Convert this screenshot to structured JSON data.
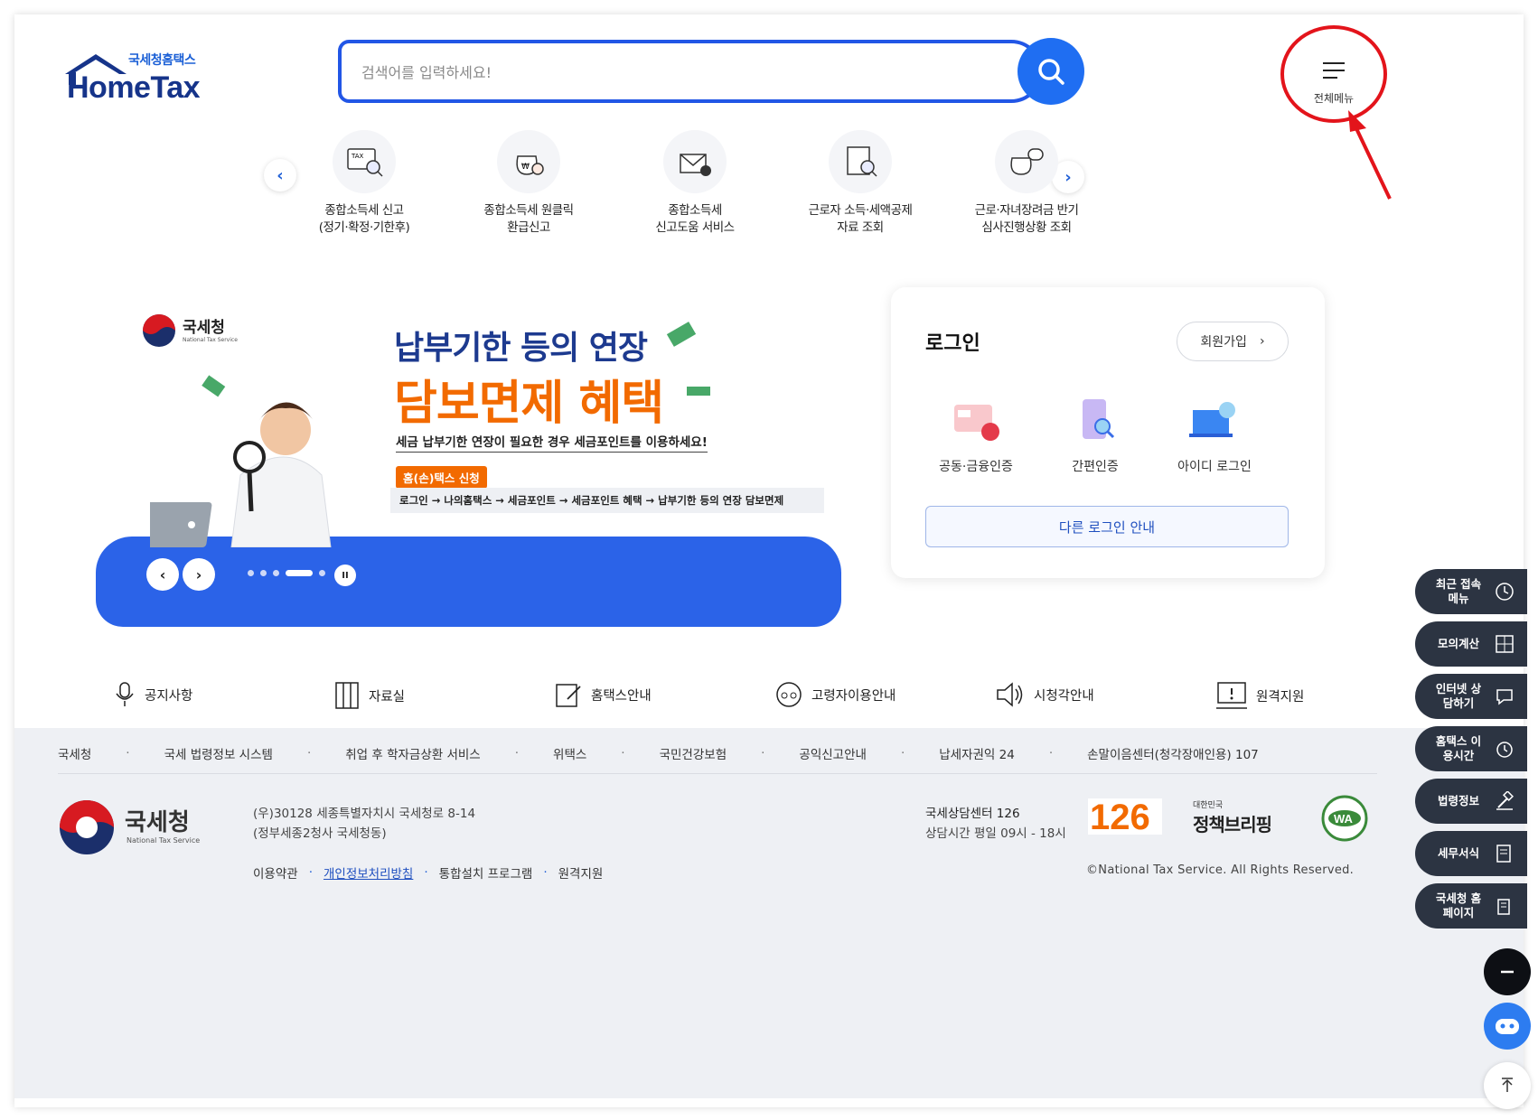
{
  "header": {
    "logo_top": "국세청홈택스",
    "logo_main": "HomeTax",
    "search_placeholder": "검색어를 입력하세요!",
    "all_menu_label": "전체메뉴"
  },
  "quick_services": [
    {
      "line1": "종합소득세 신고",
      "line2": "(정기·확정·기한후)",
      "icon": "tax-monitor-icon"
    },
    {
      "line1": "종합소득세 원클릭",
      "line2": "환급신고",
      "icon": "money-bag-search-icon"
    },
    {
      "line1": "종합소득세",
      "line2": "신고도움 서비스",
      "icon": "tax-envelope-check-icon"
    },
    {
      "line1": "근로자 소득·세액공제",
      "line2": "자료 조회",
      "icon": "document-search-icon"
    },
    {
      "line1": "근로·자녀장려금 반기",
      "line2": "심사진행상황 조회",
      "icon": "money-bag-chat-icon"
    }
  ],
  "banner": {
    "org": "국세청",
    "org_en": "National Tax Service",
    "headline1": "납부기한 등의 연장",
    "headline2": "담보면제 혜택",
    "sub": "세금 납부기한 연장이 필요한 경우 세금포인트를 이용하세요!",
    "tag": "홈(손)택스 신청",
    "path": "로그인 → 나의홈택스 → 세금포인트 → 세금포인트 혜택 → 납부기한 등의 연장 담보면제",
    "prev": "‹",
    "next": "›",
    "pause": "II"
  },
  "login": {
    "title": "로그인",
    "join": "회원가입",
    "options": [
      {
        "label": "공동·금융인증",
        "icon": "certificate-icon"
      },
      {
        "label": "간편인증",
        "icon": "phone-search-icon"
      },
      {
        "label": "아이디 로그인",
        "icon": "laptop-power-icon"
      }
    ],
    "other": "다른 로그인 안내"
  },
  "utility": [
    {
      "label": "공지사항",
      "icon": "microphone-icon"
    },
    {
      "label": "자료실",
      "icon": "archive-icon"
    },
    {
      "label": "홈택스안내",
      "icon": "edit-document-icon"
    },
    {
      "label": "고령자이용안내",
      "icon": "elderly-icon"
    },
    {
      "label": "시청각안내",
      "icon": "speaker-icon"
    },
    {
      "label": "원격지원",
      "icon": "remote-support-icon"
    }
  ],
  "footer": {
    "links": [
      "국세청",
      "국세 법령정보 시스템",
      "취업 후 학자금상환 서비스",
      "위택스",
      "국민건강보험",
      "공익신고안내",
      "납세자권익 24",
      "손말이음센터(청각장애인용) 107"
    ],
    "org": "국세청",
    "org_en": "National Tax Service",
    "address1": "(우)30128 세종특별자치시 국세청로 8-14",
    "address2": "(정부세종2청사 국세청동)",
    "links2": [
      "이용약관",
      "개인정보처리방침",
      "통합설치 프로그램",
      "원격지원"
    ],
    "center_name": "국세상담센터 126",
    "center_hours": "상담시간 평일 09시 - 18시",
    "badge_126": "126",
    "briefing_small": "대한민국",
    "briefing": "정책브리핑",
    "wa": "WA",
    "copyright": "©National Tax Service. All Rights Reserved."
  },
  "side_menu": [
    {
      "label": "최근 접속메뉴",
      "icon": "clock-icon"
    },
    {
      "label": "모의계산",
      "icon": "calculator-icon"
    },
    {
      "label": "인터넷 상담하기",
      "icon": "chat-icon"
    },
    {
      "label": "홈택스 이용시간",
      "icon": "alarm-icon"
    },
    {
      "label": "법령정보",
      "icon": "gavel-icon"
    },
    {
      "label": "세무서식",
      "icon": "form-icon"
    },
    {
      "label": "국세청 홈페이지",
      "icon": "building-icon"
    }
  ],
  "colors": {
    "brand_blue": "#1f6ef2",
    "navy": "#16348a",
    "orange": "#f26a00",
    "side_menu": "#2c3442",
    "annotation_red": "#e3141b"
  }
}
